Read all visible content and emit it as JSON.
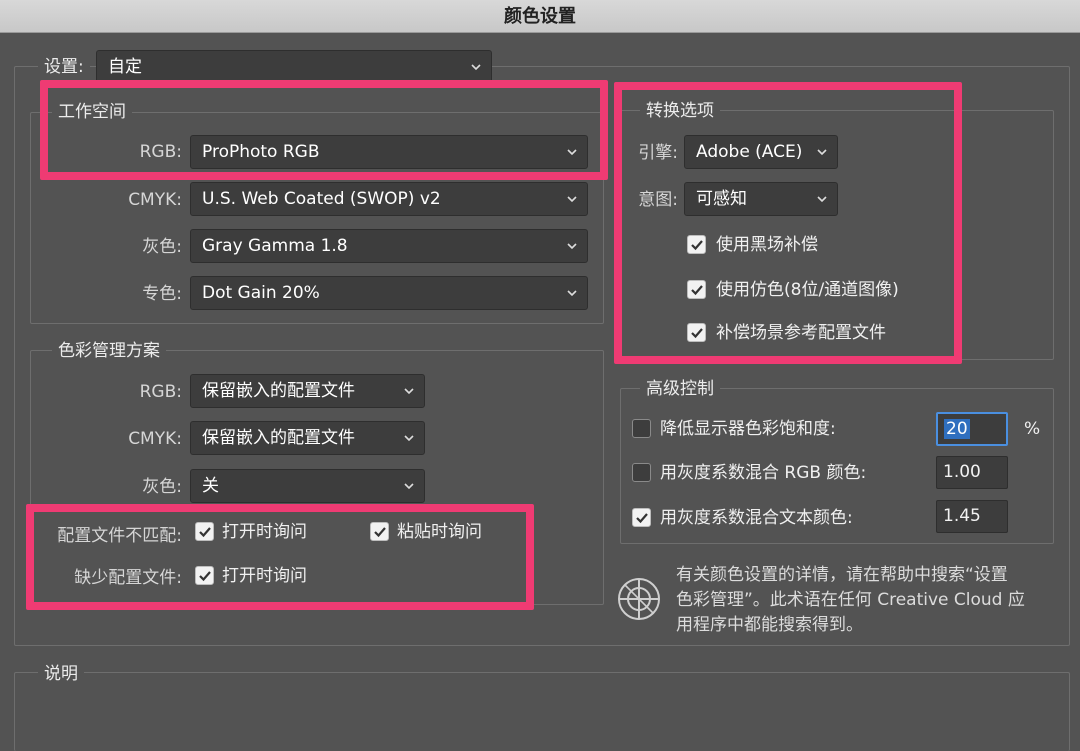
{
  "window": {
    "title": "颜色设置"
  },
  "settings": {
    "label": "设置:",
    "value": "自定"
  },
  "workspace": {
    "title": "工作空间",
    "rows": [
      {
        "label": "RGB:",
        "value": "ProPhoto RGB"
      },
      {
        "label": "CMYK:",
        "value": "U.S. Web Coated (SWOP) v2"
      },
      {
        "label": "灰色:",
        "value": "Gray Gamma 1.8"
      },
      {
        "label": "专色:",
        "value": "Dot Gain 20%"
      }
    ]
  },
  "policies": {
    "title": "色彩管理方案",
    "rows": [
      {
        "label": "RGB:",
        "value": "保留嵌入的配置文件"
      },
      {
        "label": "CMYK:",
        "value": "保留嵌入的配置文件"
      },
      {
        "label": "灰色:",
        "value": "关"
      }
    ],
    "mismatch_label": "配置文件不匹配:",
    "mismatch_open": "打开时询问",
    "mismatch_paste": "粘贴时询问",
    "missing_label": "缺少配置文件:",
    "missing_open": "打开时询问"
  },
  "conversion": {
    "title": "转换选项",
    "engine_label": "引擎:",
    "engine_value": "Adobe (ACE)",
    "intent_label": "意图:",
    "intent_value": "可感知",
    "blackpoint": "使用黑场补偿",
    "dither": "使用仿色(8位/通道图像)",
    "scene": "补偿场景参考配置文件"
  },
  "advanced": {
    "title": "高级控制",
    "desaturate_label": "降低显示器色彩饱和度:",
    "desaturate_value": "20",
    "desaturate_unit": "%",
    "blend_rgb_label": "用灰度系数混合 RGB 颜色:",
    "blend_rgb_value": "1.00",
    "blend_text_label": "用灰度系数混合文本颜色:",
    "blend_text_value": "1.45"
  },
  "help": {
    "line1": "有关颜色设置的详情，请在帮助中搜索“设置",
    "line2": "色彩管理”。此术语在任何 Creative Cloud 应",
    "line3": "用程序中都能搜索得到。"
  },
  "description": {
    "title": "说明"
  },
  "colors": {
    "highlight": "#ef3b73",
    "background": "#535353",
    "field": "#3d3d3d"
  }
}
